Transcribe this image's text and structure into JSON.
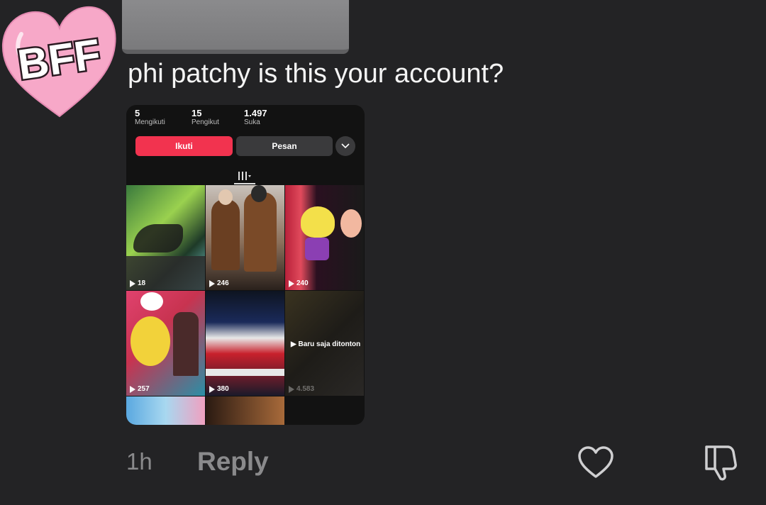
{
  "comment": {
    "avatar_text": "BFF",
    "text": "phi patchy is this your account?",
    "timestamp": "1h",
    "reply_label": "Reply"
  },
  "profile_screenshot": {
    "stats": [
      {
        "value": "5",
        "label": "Mengikuti"
      },
      {
        "value": "15",
        "label": "Pengikut"
      },
      {
        "value": "1.497",
        "label": "Suka"
      }
    ],
    "follow_label": "Ikuti",
    "message_label": "Pesan",
    "videos": [
      {
        "views": "18"
      },
      {
        "views": "246"
      },
      {
        "views": "240"
      },
      {
        "views": "257"
      },
      {
        "views": "380"
      },
      {
        "views": "4.583",
        "overlay": "Baru saja ditonton"
      }
    ]
  },
  "icons": [
    "heart-icon",
    "dislike-icon",
    "chevron-down-icon",
    "grid-icon",
    "play-icon"
  ],
  "colors": {
    "background": "#232325",
    "follow_button": "#f2334f",
    "avatar_heart": "#f7a8c8"
  }
}
